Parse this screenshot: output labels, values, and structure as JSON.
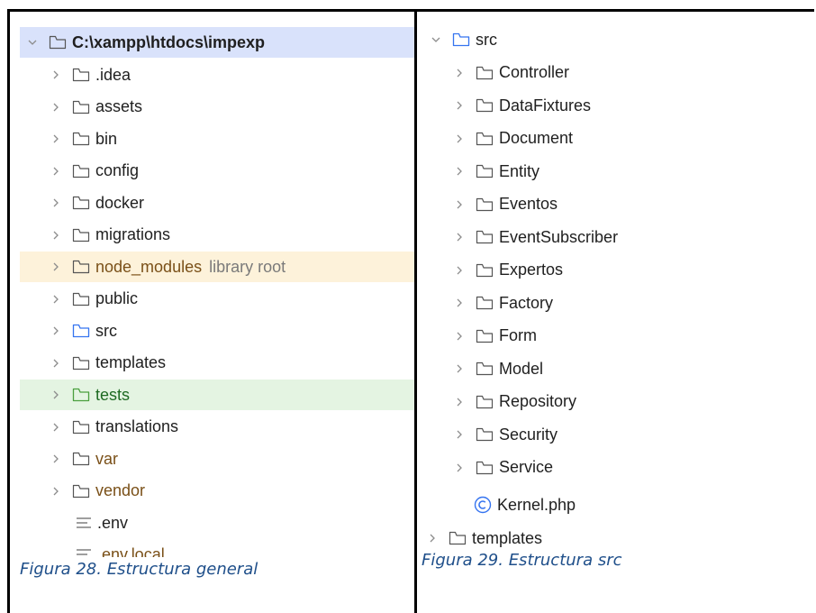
{
  "left_tree": {
    "root": "C:\\xampp\\htdocs\\impexp",
    "items": [
      {
        "label": ".idea"
      },
      {
        "label": "assets"
      },
      {
        "label": "bin"
      },
      {
        "label": "config"
      },
      {
        "label": "docker"
      },
      {
        "label": "migrations"
      },
      {
        "label": "node_modules",
        "tag": "library root"
      },
      {
        "label": "public"
      },
      {
        "label": "src"
      },
      {
        "label": "templates"
      },
      {
        "label": "tests"
      },
      {
        "label": "translations"
      },
      {
        "label": "var"
      },
      {
        "label": "vendor"
      }
    ],
    "files": [
      ".env",
      ".env.local"
    ]
  },
  "right_tree": {
    "root": "src",
    "items": [
      {
        "label": "Controller"
      },
      {
        "label": "DataFixtures"
      },
      {
        "label": "Document"
      },
      {
        "label": "Entity"
      },
      {
        "label": "Eventos"
      },
      {
        "label": "EventSubscriber"
      },
      {
        "label": "Expertos"
      },
      {
        "label": "Factory"
      },
      {
        "label": "Form"
      },
      {
        "label": "Model"
      },
      {
        "label": "Repository"
      },
      {
        "label": "Security"
      },
      {
        "label": "Service"
      }
    ],
    "kernel_file": "Kernel.php",
    "after": "templates"
  },
  "captions": {
    "left": "Figura 28. Estructura general",
    "right": "Figura 29. Estructura src"
  },
  "colors": {
    "selected_row": "#d9e2fb",
    "library_row": "#fdf2da",
    "test_row": "#e4f4e2",
    "source_folder": "#3574f0",
    "test_folder": "#4a9f3e",
    "excluded_text": "#7a5018",
    "caption": "#1f4f8a"
  }
}
